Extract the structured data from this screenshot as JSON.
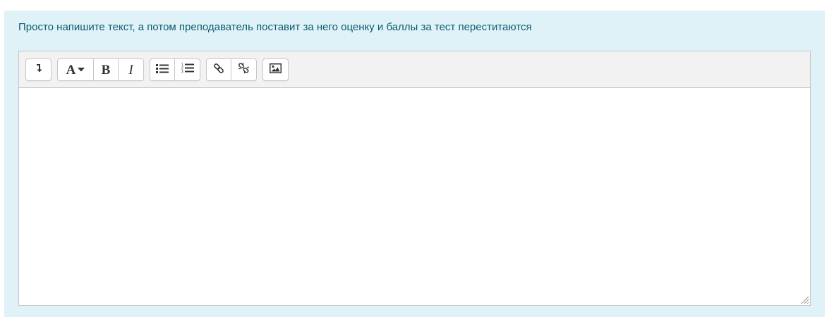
{
  "question": {
    "prompt": "Просто напишите текст, а потом преподаватель поставит за него оценку и баллы за тест переститаются"
  },
  "toolbar": {
    "groups": [
      {
        "buttons": [
          {
            "icon": "expand-toolbar-icon"
          }
        ]
      },
      {
        "buttons": [
          {
            "icon": "font-style-dropdown-icon",
            "glyph": "A"
          },
          {
            "icon": "bold-icon",
            "glyph": "B"
          },
          {
            "icon": "italic-icon",
            "glyph": "I"
          }
        ]
      },
      {
        "buttons": [
          {
            "icon": "unordered-list-icon"
          },
          {
            "icon": "ordered-list-icon"
          }
        ]
      },
      {
        "buttons": [
          {
            "icon": "link-icon"
          },
          {
            "icon": "unlink-icon"
          }
        ]
      },
      {
        "buttons": [
          {
            "icon": "image-icon"
          }
        ]
      }
    ]
  },
  "editor": {
    "content": ""
  },
  "colors": {
    "panel_background": "#def2f8",
    "prompt_text": "#0f5a73",
    "toolbar_background": "#f2f2f2",
    "editor_border": "#c5c5c5"
  }
}
